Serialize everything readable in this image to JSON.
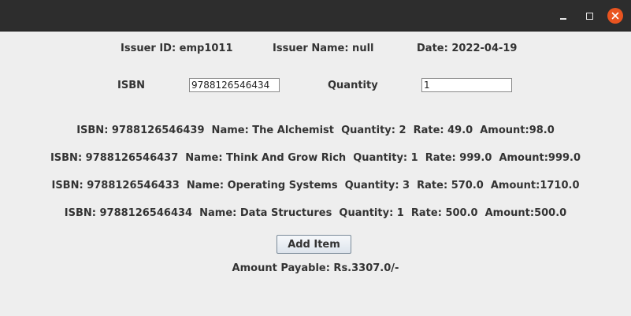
{
  "titlebar": {
    "minimize_icon": "minimize-icon",
    "maximize_icon": "maximize-icon",
    "close_icon": "close-icon",
    "close_color": "#e95420"
  },
  "header": {
    "issuer_id": "Issuer ID: emp1011",
    "issuer_name": "Issuer Name: null",
    "date": "Date: 2022-04-19"
  },
  "form": {
    "isbn_label": "ISBN",
    "isbn_value": "9788126546434",
    "quantity_label": "Quantity",
    "quantity_value": "1"
  },
  "items": [
    "ISBN: 9788126546439  Name: The Alchemist  Quantity: 2  Rate: 49.0  Amount:98.0",
    "ISBN: 9788126546437  Name: Think And Grow Rich  Quantity: 1  Rate: 999.0  Amount:999.0",
    "ISBN: 9788126546433  Name: Operating Systems  Quantity: 3  Rate: 570.0  Amount:1710.0",
    "ISBN: 9788126546434  Name: Data Structures  Quantity: 1  Rate: 500.0  Amount:500.0"
  ],
  "add_button_label": "Add Item",
  "amount_payable": "Amount Payable: Rs.3307.0/-"
}
